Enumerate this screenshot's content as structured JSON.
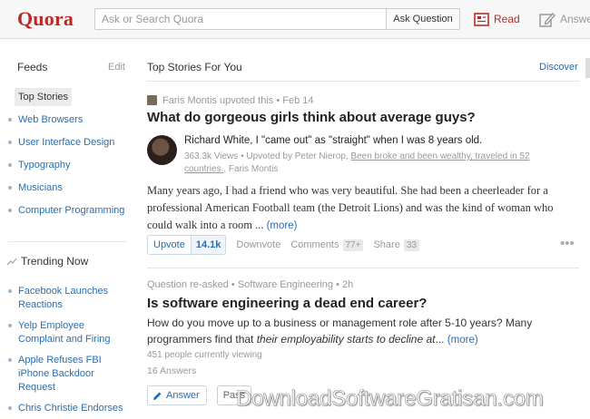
{
  "header": {
    "logo": "Quora",
    "search_placeholder": "Ask or Search Quora",
    "ask_button": "Ask Question",
    "nav_read": "Read",
    "nav_answer": "Answer",
    "brand_color": "#b92b27",
    "link_color": "#2b6dad"
  },
  "sidebar": {
    "feeds_title": "Feeds",
    "edit": "Edit",
    "feeds": [
      "Top Stories",
      "Web Browsers",
      "User Interface Design",
      "Typography",
      "Musicians",
      "Computer Programming"
    ],
    "trending_title": "Trending Now",
    "trending": [
      "Facebook Launches Reactions",
      "Yelp Employee Complaint and Firing",
      "Apple Refuses FBI iPhone Backdoor Request",
      "Chris Christie Endorses"
    ]
  },
  "main": {
    "title": "Top Stories For You",
    "discover": "Discover",
    "story1": {
      "upvoter_meta": "Faris Montis upvoted this • Feb 14",
      "question": "What do gorgeous girls think about average guys?",
      "author_line": "Richard White, I \"came out\" as \"straight\" when I was 8 years old.",
      "stats_prefix": "363.3k Views • Upvoted by Peter Nierop, ",
      "stats_link": "Been broke and been wealthy, traveled in 52 countries.",
      "stats_suffix": ", Faris Montis",
      "answer_text": "Many years ago, I had a friend who was very beautiful. She had been a cheerleader for a professional American Football team (the Detroit Lions) and was the kind of woman who could walk into a room ...",
      "more": "(more)",
      "upvote_label": "Upvote",
      "upvote_count": "14.1k",
      "downvote": "Downvote",
      "comments": "Comments",
      "comments_count": "77+",
      "share": "Share",
      "share_count": "33"
    },
    "story2": {
      "meta_prefix": "Question re-asked • ",
      "meta_topic": "Software Engineering",
      "meta_suffix": " • 2h",
      "question": "Is software engineering a dead end career?",
      "details_plain": "How do you move up to a business or management role after 5-10 years? Many programmers find that ",
      "details_italic": "their employability starts to decline at",
      "details_end": "...",
      "more": "(more)",
      "viewing": "451 people currently viewing",
      "answers": "16 Answers",
      "answer_button": "Answer",
      "pass_button": "Pass"
    }
  },
  "watermark": "DownloadSoftwareGratisan.com"
}
